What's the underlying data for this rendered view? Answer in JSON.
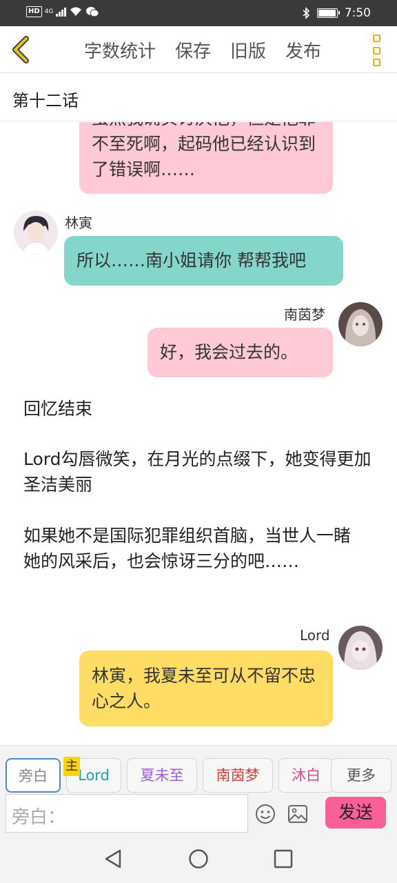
{
  "status_bar": {
    "hd": "HD",
    "network": "4G",
    "time": "7:50",
    "battery_level": 0.95,
    "icons": [
      "wifi-icon",
      "wechat-icon",
      "bluetooth-icon",
      "battery-icon"
    ]
  },
  "toolbar": {
    "actions": [
      "字数统计",
      "保存",
      "旧版",
      "发布"
    ]
  },
  "chapter_title": "第十二话",
  "messages": {
    "m1_text": "虽然我确实讨厌他，但是他罪不至死啊，起码他已经认识到了错误啊……",
    "m2_sender": "林寅",
    "m2_text": "所以……南小姐请你 帮帮我吧",
    "m3_sender": "南茵梦",
    "m3_text": "好，我会过去的。",
    "narration_1": "回忆结束",
    "narration_2": "Lord勾唇微笑，在月光的点缀下，她变得更加圣洁美丽",
    "narration_3": "如果她不是国际犯罪组织首脑，当世人一睹她的风采后，也会惊讶三分的吧……",
    "m4_sender": "Lord",
    "m4_text": "林寅，我夏未至可从不留不忠心之人。"
  },
  "composer": {
    "roles": [
      {
        "label": "旁白",
        "color": "#888888"
      },
      {
        "label": "Lord",
        "color": "#1aa9a0"
      },
      {
        "label": "夏未至",
        "color": "#a05cd6"
      },
      {
        "label": "南茵梦",
        "color": "#d43c3c"
      },
      {
        "label": "沐白",
        "color": "#e04a8a"
      }
    ],
    "host_tag": "主",
    "more_label": "更多",
    "input_placeholder": "旁白：",
    "send_label": "发送"
  },
  "colors": {
    "pink_bubble": "#ffc9d6",
    "teal_bubble": "#84d6cb",
    "yellow_bubble": "#ffdc64",
    "accent": "#e3b400",
    "send": "#fb5f98"
  }
}
